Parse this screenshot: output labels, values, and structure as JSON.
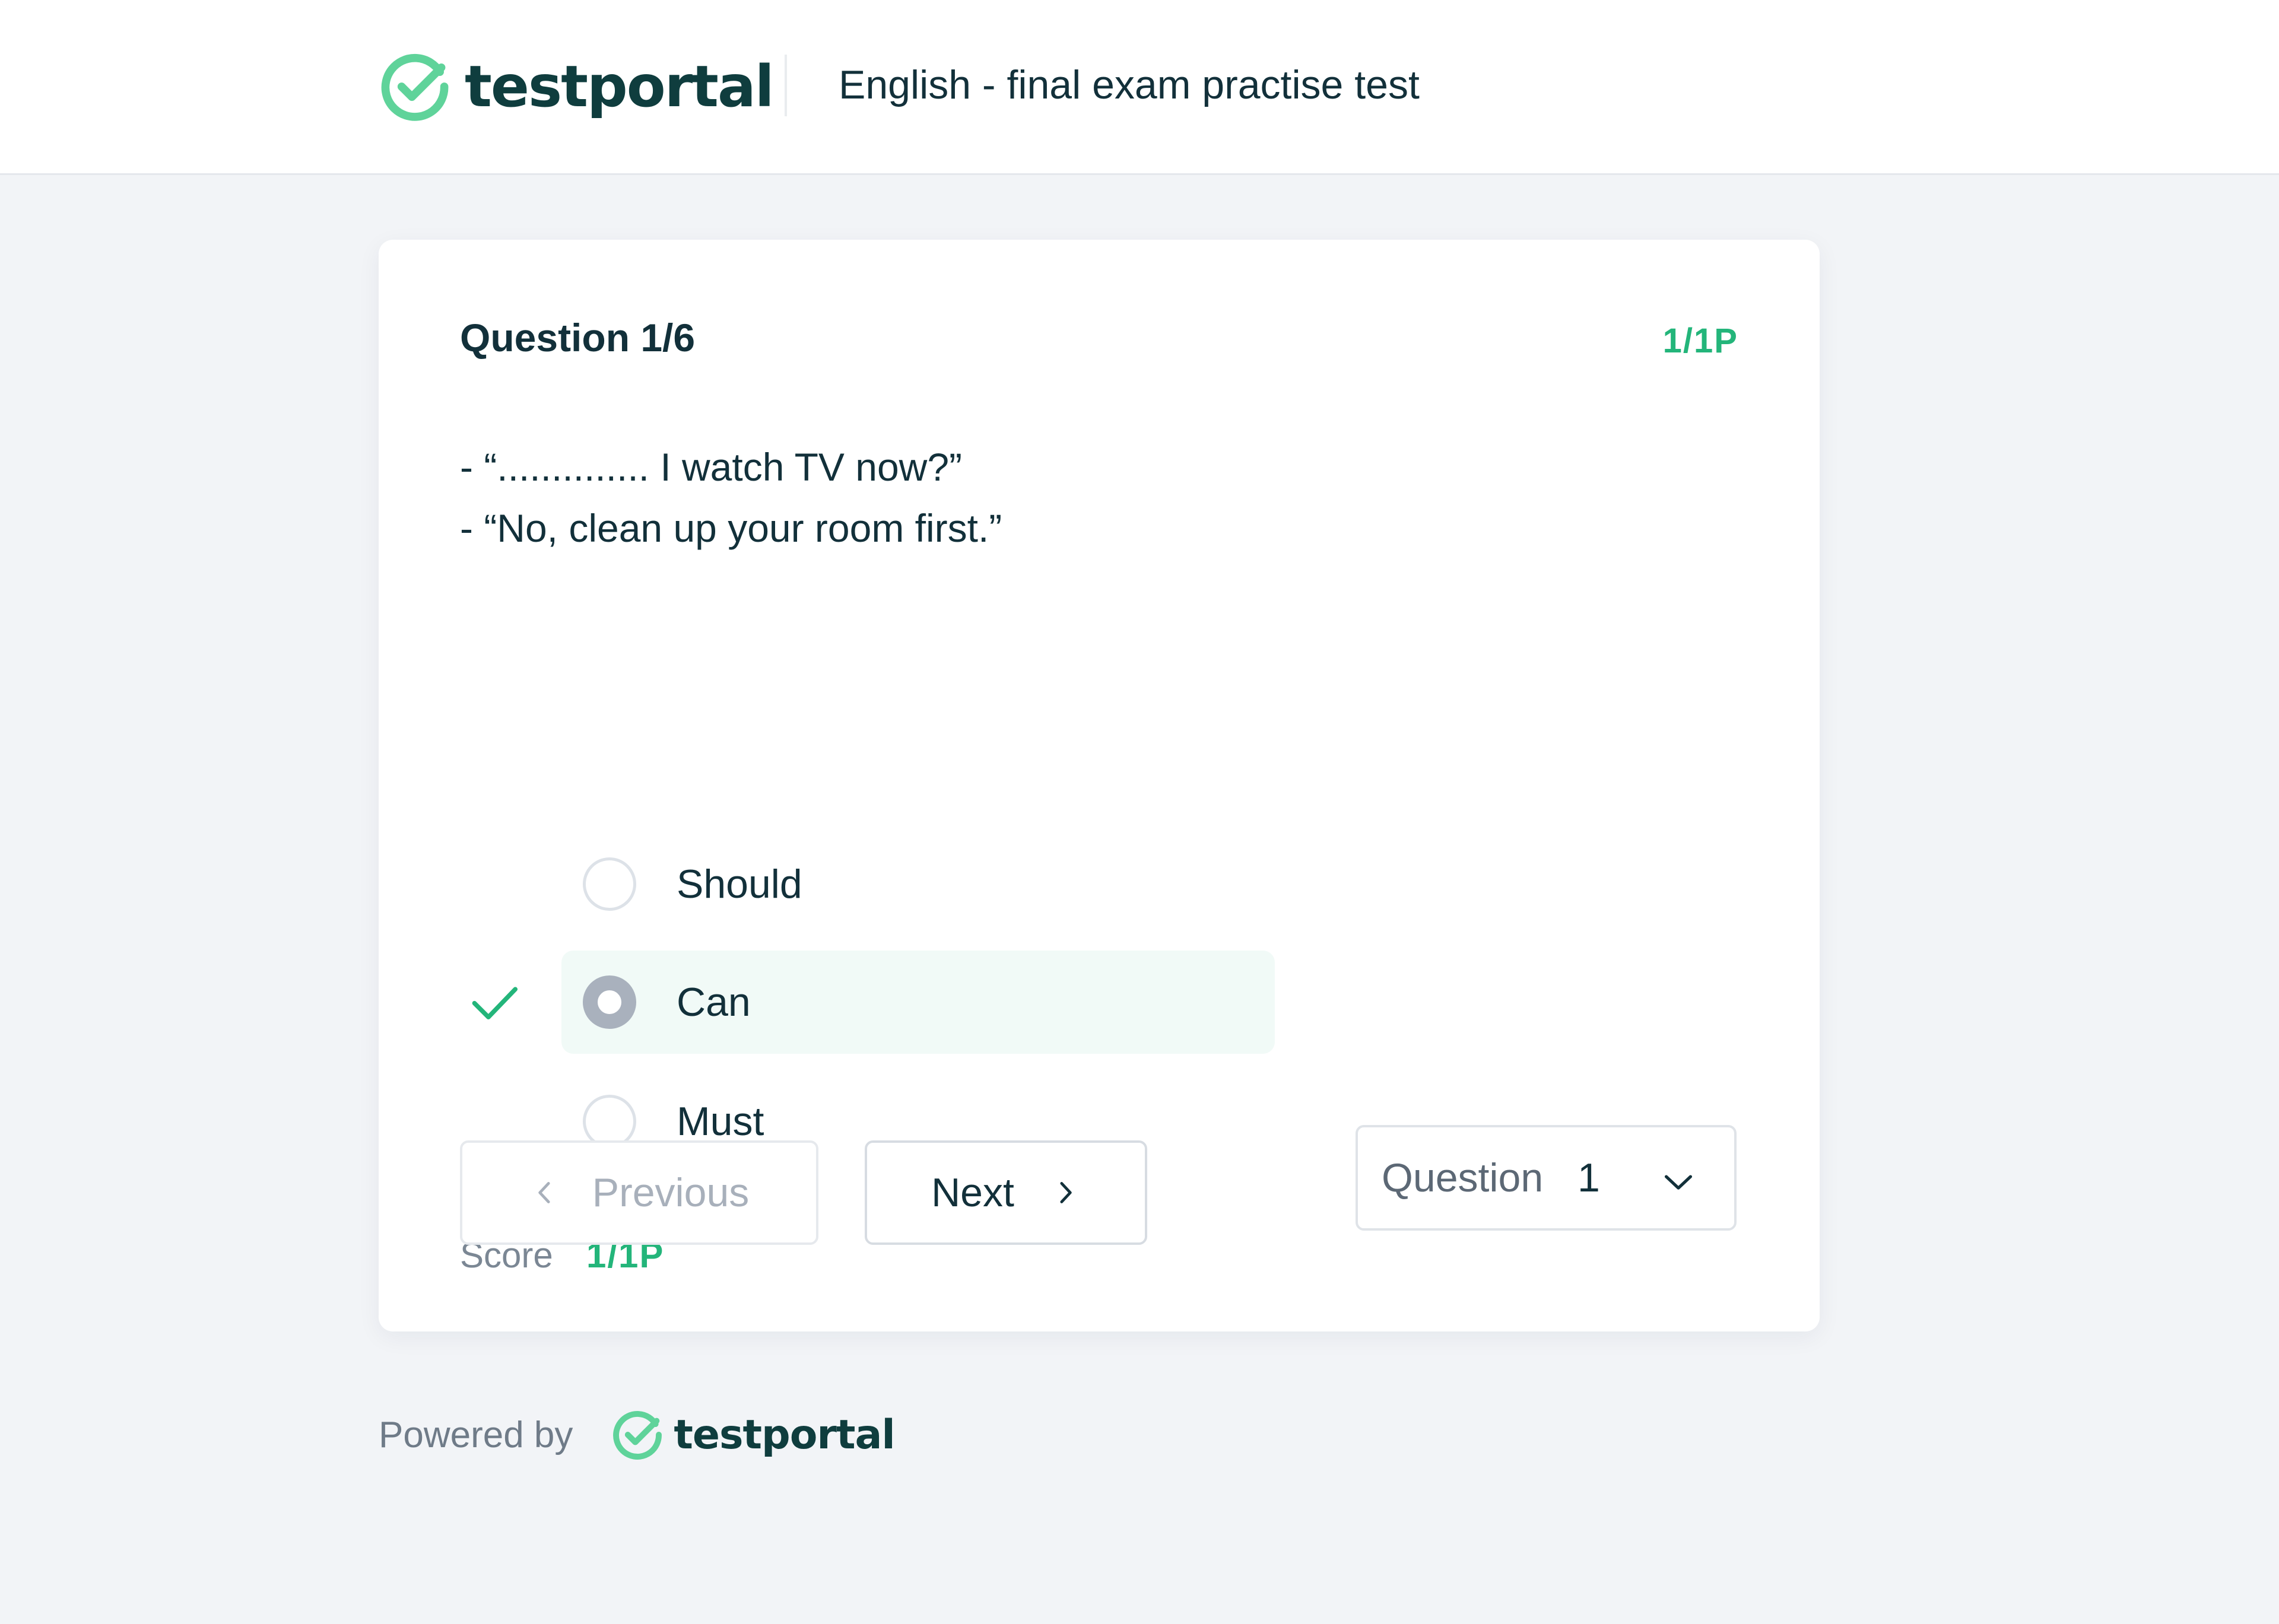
{
  "header": {
    "logo_text": "testportal",
    "exam_title": "English - final exam practise test"
  },
  "question": {
    "number_label": "Question 1/6",
    "points": "1/1P",
    "text_line1": "- “.............. I watch TV now?”",
    "text_line2": "- “No, clean up your room first.”",
    "answers": [
      {
        "label": "Should",
        "selected": false,
        "correct": false
      },
      {
        "label": "Can",
        "selected": true,
        "correct": true
      },
      {
        "label": "Must",
        "selected": false,
        "correct": false
      }
    ]
  },
  "score": {
    "label": "Score",
    "value": "1/1P"
  },
  "navigation": {
    "previous_label": "Previous",
    "next_label": "Next",
    "question_select_label": "Question",
    "question_select_value": "1"
  },
  "footer": {
    "powered_by": "Powered by",
    "logo_text": "testportal"
  },
  "colors": {
    "brand_green": "#23b57a",
    "logo_green": "#5fd39a",
    "text_dark": "#12303a",
    "page_bg": "#f2f4f7"
  }
}
